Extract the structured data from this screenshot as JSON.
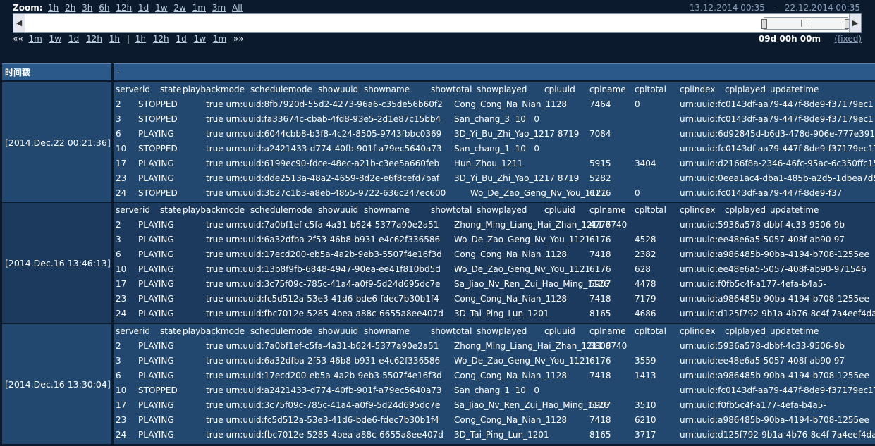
{
  "zoom": {
    "label": "Zoom:",
    "links": [
      "1h",
      "2h",
      "3h",
      "6h",
      "12h",
      "1d",
      "1w",
      "2w",
      "1m",
      "3m",
      "All"
    ],
    "range_start": "13.12.2014 00:35",
    "range_sep": "-",
    "range_end": "22.12.2014 00:35"
  },
  "nav": {
    "back_symbol": "««",
    "back_links": [
      "1m",
      "1w",
      "1d",
      "12h",
      "1h"
    ],
    "separator": "|",
    "fwd_links": [
      "1h",
      "12h",
      "1d",
      "1w",
      "1m"
    ],
    "fwd_symbol": "»»",
    "duration": "09d 00h 00m",
    "fixed": "(fixed)"
  },
  "table": {
    "time_header": "时间戳",
    "data_header": "-",
    "columns": [
      "serverid",
      "state",
      "playbackmode",
      "schedulemode",
      "showuuid",
      "showname",
      "showtotal",
      "showplayed",
      "cpluuid",
      "cplname",
      "cpltotal",
      "cplindex",
      "cplplayed",
      "updatetime"
    ],
    "blocks": [
      {
        "timestamp": "[2014.Dec.22 00:21:36]",
        "rows": [
          [
            "2",
            "STOPPED",
            "true urn:uuid:8fb7920d-55d2-4273-96a6-c35de56b60f2",
            "Cong_Cong_Na_Nian_1128",
            "7464",
            "0",
            "urn:uuid:fc0143df-aa79-447f-8de9-f37179ec173e"
          ],
          [
            "3",
            "STOPPED",
            "true urn:uuid:fa33674c-cbab-4fd8-93e5-2d1e87c15bb4",
            "San_chang_3  10   0",
            "",
            "",
            "urn:uuid:fc0143df-aa79-447f-8de9-f37179ec173e   Black_10s_JPEG"
          ],
          [
            "6",
            "PLAYING",
            "true urn:uuid:6044cbb8-b3f8-4c24-8505-9743fbbc0369",
            "3D_Yi_Bu_Zhi_Yao_1217 8719",
            "7084",
            "",
            "urn:uuid:6d92845d-b6d3-478d-906e-777e391869"
          ],
          [
            "10",
            "STOPPED",
            "true urn:uuid:a2421433-d774-40fb-901f-a79ec5640a73",
            "San_chang_1  10   0",
            "",
            "",
            "urn:uuid:fc0143df-aa79-447f-8de9-f37179ec173e   Black_10s_JPEG"
          ],
          [
            "17",
            "PLAYING",
            "true urn:uuid:6199ec90-fdce-48ec-a21b-c3ee5a660feb",
            "Hun_Zhou_1211",
            "5915",
            "3404",
            "urn:uuid:d2166f8a-2346-46fc-95ac-6c350ffc15fc   Hu"
          ],
          [
            "23",
            "PLAYING",
            "true urn:uuid:dde2513a-48a2-4659-8d2e-e6f8cefd7baf",
            "3D_Yi_Bu_Zhi_Yao_1217 8719",
            "5282",
            "",
            "urn:uuid:0eea1ac4-dba1-485b-a2d5-1dbea7d59ef"
          ],
          [
            "24",
            "STOPPED",
            "true urn:uuid:3b27c1b3-a8eb-4855-9722-636c247ec600",
            "      Wo_De_Zao_Geng_Nv_You_1121",
            "6176",
            "0",
            "urn:uuid:fc0143df-aa79-447f-8de9-f37"
          ]
        ]
      },
      {
        "timestamp": "[2014.Dec.16 13:46:13]",
        "rows": [
          [
            "2",
            "PLAYING",
            "true urn:uuid:7a0bf1ef-c5fa-4a31-b624-5377a90e2a51",
            "Zhong_Ming_Liang_Hai_Zhan_1211 6740",
            "4777",
            "",
            "urn:uuid:5936a578-dbbf-4c33-9506-9b"
          ],
          [
            "3",
            "PLAYING",
            "true urn:uuid:6a32dfba-2f53-46b8-b931-e4c62f336586",
            "Wo_De_Zao_Geng_Nv_You_1121",
            "6176",
            "4528",
            "urn:uuid:ee48e6a5-5057-408f-ab90-97"
          ],
          [
            "6",
            "PLAYING",
            "true urn:uuid:17ecd200-eb5a-4a2b-9eb3-5507f4e16f3d",
            "Cong_Cong_Na_Nian_1128",
            "7418",
            "2382",
            "urn:uuid:a986485b-90ba-4194-b708-1255ee"
          ],
          [
            "10",
            "PLAYING",
            "true urn:uuid:13b8f9fb-6848-4947-90ea-ee41f810bd5d",
            "Wo_De_Zao_Geng_Nv_You_1121",
            "6176",
            "628",
            "urn:uuid:ee48e6a5-5057-408f-ab90-971546"
          ],
          [
            "17",
            "PLAYING",
            "true urn:uuid:3c75f09c-785c-41a4-a0f9-5d24d695dc7e",
            "Sa_Jiao_Nv_Ren_Zui_Hao_Ming_1126",
            "5907",
            "4478",
            "urn:uuid:f0fb5c4f-a177-4efa-b4a5-"
          ],
          [
            "23",
            "PLAYING",
            "true urn:uuid:fc5d512a-53e3-41d6-bde6-fdec7b30b1f4",
            "Cong_Cong_Na_Nian_1128",
            "7418",
            "7179",
            "urn:uuid:a986485b-90ba-4194-b708-1255ee"
          ],
          [
            "24",
            "PLAYING",
            "true urn:uuid:fbc7012e-5285-4bea-a88c-6655a8ee407d",
            "3D_Tai_Ping_Lun_1201",
            "8165",
            "4686",
            "urn:uuid:d125f792-9b1a-4b76-8c4f-7a4eef4da786"
          ]
        ]
      },
      {
        "timestamp": "[2014.Dec.16 13:30:04]",
        "rows": [
          [
            "2",
            "PLAYING",
            "true urn:uuid:7a0bf1ef-c5fa-4a31-b624-5377a90e2a51",
            "Zhong_Ming_Liang_Hai_Zhan_1211 6740",
            "3808",
            "",
            "urn:uuid:5936a578-dbbf-4c33-9506-9b"
          ],
          [
            "3",
            "PLAYING",
            "true urn:uuid:6a32dfba-2f53-46b8-b931-e4c62f336586",
            "Wo_De_Zao_Geng_Nv_You_1121",
            "6176",
            "3559",
            "urn:uuid:ee48e6a5-5057-408f-ab90-97"
          ],
          [
            "6",
            "PLAYING",
            "true urn:uuid:17ecd200-eb5a-4a2b-9eb3-5507f4e16f3d",
            "Cong_Cong_Na_Nian_1128",
            "7418",
            "1413",
            "urn:uuid:a986485b-90ba-4194-b708-1255ee"
          ],
          [
            "10",
            "STOPPED",
            "true urn:uuid:a2421433-d774-40fb-901f-a79ec5640a73",
            "San_chang_1  10   0",
            "",
            "",
            "urn:uuid:fc0143df-aa79-447f-8de9-f37179ec173e   Black_10s_JPEG"
          ],
          [
            "17",
            "PLAYING",
            "true urn:uuid:3c75f09c-785c-41a4-a0f9-5d24d695dc7e",
            "Sa_Jiao_Nv_Ren_Zui_Hao_Ming_1126",
            "5907",
            "3510",
            "urn:uuid:f0fb5c4f-a177-4efa-b4a5-"
          ],
          [
            "23",
            "PLAYING",
            "true urn:uuid:fc5d512a-53e3-41d6-bde6-fdec7b30b1f4",
            "Cong_Cong_Na_Nian_1128",
            "7418",
            "6210",
            "urn:uuid:a986485b-90ba-4194-b708-1255ee"
          ],
          [
            "24",
            "PLAYING",
            "true urn:uuid:fbc7012e-5285-4bea-a88c-6655a8ee407d",
            "3D_Tai_Ping_Lun_1201",
            "8165",
            "3717",
            "urn:uuid:d125f792-9b1a-4b76-8c4f-7a4eef4da786"
          ]
        ]
      }
    ]
  }
}
